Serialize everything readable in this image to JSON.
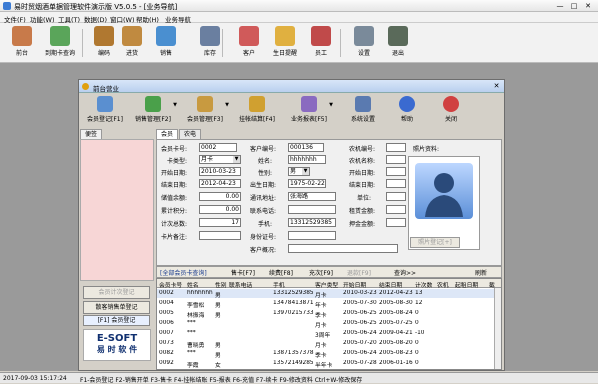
{
  "window": {
    "title": "易时贸烟酒单据管理软件演示版 V5.0.5 - [业务导航]",
    "min": "—",
    "max": "□",
    "close": "✕"
  },
  "menu": [
    "文件(F)",
    "功能(W)",
    "工具(T)",
    "数据(D)",
    "窗口(W)",
    "帮助(H)",
    "业务导航"
  ],
  "toolbar": [
    "前台",
    "到期卡查询",
    "编码",
    "进货",
    "销售",
    "库存",
    "客户",
    "生日提醒",
    "员工",
    "设置",
    "退出"
  ],
  "dialog": {
    "title": "前台营业",
    "close": "✕",
    "tools": [
      "会员登记[F1]",
      "销售管理[F2]",
      "会员管理[F3]",
      "挂帐结算[F4]",
      "业务报表[F5]",
      "系统设置",
      "帮助",
      "关闭"
    ],
    "left_tab": "便签",
    "left_buttons": [
      "会员计次登记",
      "散客销售单登记",
      "[F1] 会员登记"
    ],
    "logo_line1": "E-SOFT",
    "logo_line2": "易 时 软 件",
    "form_tabs": [
      "会员",
      "农电"
    ],
    "labels": {
      "card_no": "会员卡号:",
      "card_type": "卡类型:",
      "start_date": "开始日期:",
      "end_date": "结束日期:",
      "balance": "储值余额:",
      "points": "累计积分:",
      "count": "计次总数:",
      "card_note": "卡片备注:",
      "cust_no": "客户编号:",
      "name": "姓名:",
      "gender": "性别:",
      "birth": "出生日期:",
      "address": "通讯地址:",
      "contact_tel": "联系电话:",
      "mobile": "手机:",
      "id_no": "身份证号:",
      "overview": "客户概况:",
      "farm_no": "农机编号:",
      "farm_name": "农机名称:",
      "open_date": "开始日期:",
      "close_date": "结束日期:",
      "unit": "单位:",
      "rent_price": "租赁金额:",
      "deposit": "押金金额:",
      "photo": "照片资料:"
    },
    "values": {
      "card_no": "0002",
      "card_type": "月卡",
      "start_date": "2010-03-23",
      "end_date": "2012-04-23",
      "balance": "0.00",
      "points": "0.00",
      "count": "17",
      "cust_no": "000136",
      "name": "hhhhhhh",
      "gender": "男",
      "birth": "1975-02-22",
      "address": "张海路",
      "mobile": "13312529385"
    },
    "photo_button": "照片登记[+]",
    "query_bar": [
      "[全部会员卡查询]",
      "售卡[F7]",
      "续费[F8]",
      "充次[F9]",
      "退款[F9]",
      "查询>>",
      "刷新"
    ],
    "grid_headers": [
      "会员卡号",
      "姓名",
      "性别",
      "联系电话",
      "手机",
      "客户类型",
      "开始日期",
      "结束日期",
      "计次数",
      "农机",
      "起租日期",
      "截"
    ],
    "grid_rows": [
      [
        "0002",
        "hhhhhhh",
        "男",
        "",
        "13312529385",
        "月卡",
        "2010-03-23",
        "2012-04-23",
        "13",
        "",
        "",
        ""
      ],
      [
        "0004",
        "李雪松",
        "男",
        "",
        "13478413871",
        "年卡",
        "2005-07-30",
        "2005-08-30",
        "12",
        "",
        "",
        ""
      ],
      [
        "0005",
        "林振海",
        "男",
        "",
        "13970215733",
        "季卡",
        "2005-06-25",
        "2005-08-24",
        "0",
        "",
        "",
        ""
      ],
      [
        "0006",
        "***",
        "",
        "",
        "",
        "月卡",
        "2005-06-25",
        "2005-07-25",
        "0",
        "",
        "",
        ""
      ],
      [
        "0007",
        "***",
        "",
        "",
        "",
        "3周年",
        "2005-06-24",
        "2009-04-21",
        "-10",
        "",
        "",
        ""
      ],
      [
        "0073",
        "曹晓勇",
        "男",
        "",
        "",
        "月卡",
        "2005-07-20",
        "2005-08-20",
        "0",
        "",
        "",
        ""
      ],
      [
        "0082",
        "***",
        "男",
        "",
        "13871357378",
        "季卡",
        "2005-06-24",
        "2005-08-23",
        "0",
        "",
        "",
        ""
      ],
      [
        "0092",
        "李霞",
        "女",
        "",
        "13572149285",
        "半年卡",
        "2005-07-28",
        "2006-01-16",
        "0",
        "",
        "",
        ""
      ]
    ]
  },
  "status": {
    "datetime": "2017-09-03 15:17:24",
    "shortcuts": "F1-会员登记 F2-销售开单 F3-售卡 F4-挂帐结账 F5-报表 F6-充值 F7-续卡 F9-修改资料 Ctrl+W-修改保存"
  },
  "colors": {
    "accent": "#3b7bd4",
    "left_panel": "#f7d6d6",
    "workspace": "#9a9a9a",
    "query_link": "#1a3c8f"
  }
}
